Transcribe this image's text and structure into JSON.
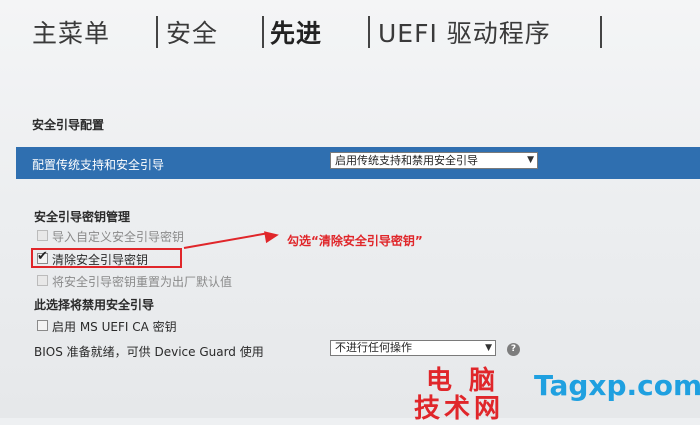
{
  "tabs": [
    {
      "label": "主菜单",
      "active": false
    },
    {
      "label": "安全",
      "active": false
    },
    {
      "label": "先进",
      "active": true
    },
    {
      "label": "UEFI 驱动程序",
      "active": false
    }
  ],
  "secure_boot_config": {
    "title": "安全引导配置",
    "config_label": "配置传统支持和安全引导",
    "config_value": "启用传统支持和禁用安全引导"
  },
  "key_management": {
    "title": "安全引导密钥管理",
    "items": [
      {
        "label": "导入自定义安全引导密钥",
        "checked": false,
        "disabled": true
      },
      {
        "label": "清除安全引导密钥",
        "checked": true,
        "disabled": false
      },
      {
        "label": "将安全引导密钥重置为出厂默认值",
        "checked": false,
        "disabled": true
      }
    ]
  },
  "ms_ca": {
    "title": "此选择将禁用安全引导",
    "checkbox_label": "启用 MS UEFI CA 密钥",
    "checked": false
  },
  "bios_ready": {
    "label": "BIOS 准备就绪，可供 Device Guard 使用",
    "value": "不进行任何操作"
  },
  "annotation": {
    "text": "勾选“清除安全引导密钥”",
    "color": "#e0262a"
  },
  "watermark": {
    "cn_line1": "电 脑",
    "cn_line2": "技术网",
    "en": "Tagxp.com"
  },
  "colors": {
    "selection_bar": "#2f6fb0",
    "annotation": "#e0262a",
    "watermark_blue": "#1fa0e0"
  }
}
